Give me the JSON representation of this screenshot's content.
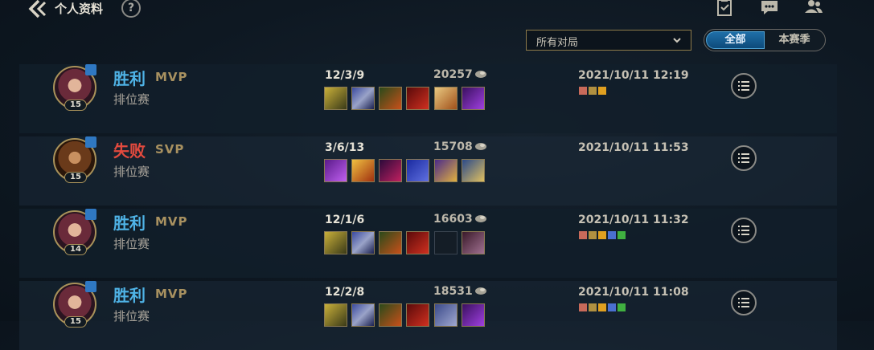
{
  "header": {
    "title": "个人资料",
    "help": "?"
  },
  "filters": {
    "dropdown_value": "所有对局",
    "segment_all": "全部",
    "segment_season": "本赛季"
  },
  "matches": [
    {
      "result": "胜利",
      "badge": "MVP",
      "mode": "排位赛",
      "level": "15",
      "kda": "12/3/9",
      "gold": "20257",
      "date": "2021/10/11 12:19"
    },
    {
      "result": "失败",
      "badge": "SVP",
      "mode": "排位赛",
      "level": "15",
      "kda": "3/6/13",
      "gold": "15708",
      "date": "2021/10/11 11:53"
    },
    {
      "result": "胜利",
      "badge": "MVP",
      "mode": "排位赛",
      "level": "14",
      "kda": "12/1/6",
      "gold": "16603",
      "date": "2021/10/11 11:32"
    },
    {
      "result": "胜利",
      "badge": "MVP",
      "mode": "排位赛",
      "level": "15",
      "kda": "12/2/8",
      "gold": "18531",
      "date": "2021/10/11 11:08"
    }
  ],
  "colors": {
    "win": "#4fb3e6",
    "lose": "#e24a3e",
    "gold_accent": "#a89160",
    "segment_active": "#1f6fa8"
  },
  "icons": {
    "back": "chevron-left-icon",
    "help": "question-icon",
    "clipboard": "clipboard-icon",
    "chat": "chat-icon",
    "friends": "friends-icon",
    "detail": "list-icon"
  }
}
